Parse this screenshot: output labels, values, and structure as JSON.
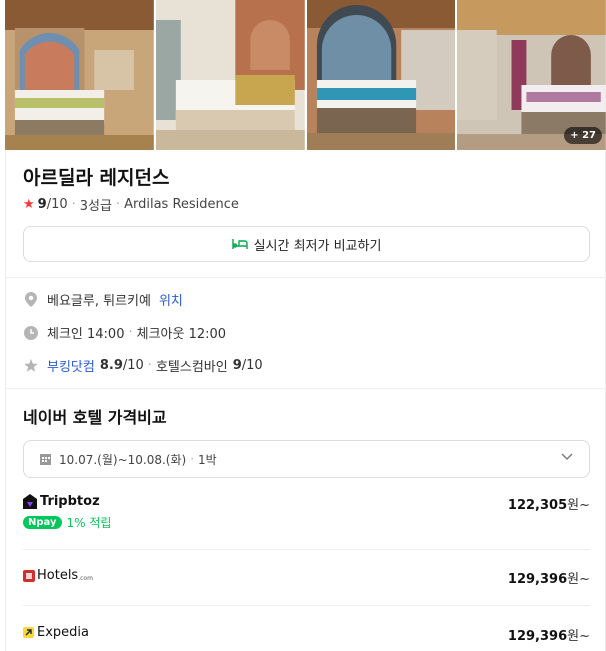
{
  "gallery": {
    "more_count": "+ 27"
  },
  "hotel": {
    "name": "아르딜라 레지던스",
    "rating": "9",
    "rating_suffix": "/10",
    "grade": "3성급",
    "english_name": "Ardilas Residence",
    "compare_button": "실시간 최저가 비교하기"
  },
  "info": {
    "location": "베요글루, 튀르키예",
    "location_link": "위치",
    "checkin": "체크인 14:00",
    "checkout": "체크아웃 12:00",
    "review_source_1": "부킹닷컴",
    "review_score_1": "8.9",
    "review_suffix_1": "/10",
    "review_source_2": "호텔스컴바인",
    "review_score_2": "9",
    "review_suffix_2": "/10"
  },
  "price_compare": {
    "title": "네이버 호텔 가격비교",
    "date_range": "10.07.(월)~10.08.(화)",
    "nights": "1박",
    "vendors": [
      {
        "name": "Tripbtoz",
        "price": "122,305",
        "unit": "원~",
        "npay_label": "pay",
        "npay_benefit": "1% 적립"
      },
      {
        "name": "Hotels",
        "sub": ".com",
        "price": "129,396",
        "unit": "원~"
      },
      {
        "name": "Expedia",
        "price": "129,396",
        "unit": "원~"
      }
    ]
  }
}
